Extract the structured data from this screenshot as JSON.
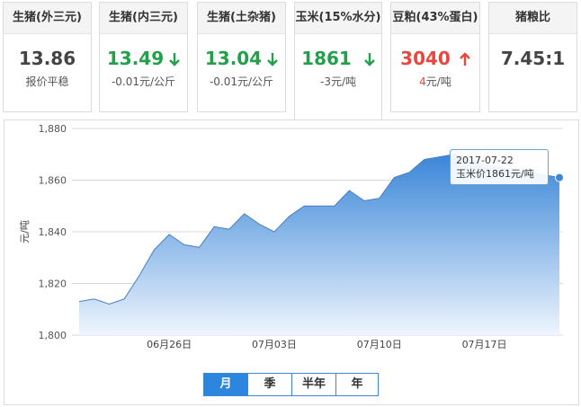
{
  "cards": [
    {
      "title": "生猪(外三元)",
      "value": "13.86",
      "sub": "报价平稳",
      "trend": "none"
    },
    {
      "title": "生猪(内三元)",
      "value": "13.49",
      "sub": "-0.01元/公斤",
      "trend": "down"
    },
    {
      "title": "生猪(土杂猪)",
      "value": "13.04",
      "sub": "-0.01元/公斤",
      "trend": "down"
    },
    {
      "title": "玉米(15%水分)",
      "value": "1861",
      "sub": "-3元/吨",
      "trend": "down"
    },
    {
      "title": "豆粕(43%蛋白)",
      "value": "3040",
      "sub_num": "4",
      "sub_unit": "元/吨",
      "trend": "up"
    },
    {
      "title": "猪粮比",
      "value": "7.45:1",
      "trend": "none"
    }
  ],
  "colors": {
    "down": "#23a04a",
    "up": "#e8463f",
    "accent": "#2c86de",
    "area_top": "#3a86d8",
    "area_bottom": "#eef5fd"
  },
  "tooltip": {
    "date": "2017-07-22",
    "text": "玉米价1861元/吨"
  },
  "tabs": [
    {
      "label": "月",
      "active": true
    },
    {
      "label": "季"
    },
    {
      "label": "半年"
    },
    {
      "label": "年"
    }
  ],
  "chart_data": {
    "type": "area",
    "ylabel": "元/吨",
    "ylim": [
      1800,
      1880
    ],
    "yticks": [
      "1,880",
      "1,860",
      "1,840",
      "1,820",
      "1,800"
    ],
    "xtick_labels": [
      "06月26日",
      "07月03日",
      "07月10日",
      "07月17日"
    ],
    "xtick_dates": [
      "2017-06-26",
      "2017-07-03",
      "2017-07-10",
      "2017-07-17"
    ],
    "grid": true,
    "series": [
      {
        "x": [
          "2017-06-20",
          "2017-06-21",
          "2017-06-22",
          "2017-06-23",
          "2017-06-24",
          "2017-06-25",
          "2017-06-26",
          "2017-06-27",
          "2017-06-28",
          "2017-06-29",
          "2017-06-30",
          "2017-07-01",
          "2017-07-02",
          "2017-07-03",
          "2017-07-04",
          "2017-07-05",
          "2017-07-06",
          "2017-07-07",
          "2017-07-08",
          "2017-07-09",
          "2017-07-10",
          "2017-07-11",
          "2017-07-12",
          "2017-07-13",
          "2017-07-14",
          "2017-07-15",
          "2017-07-16",
          "2017-07-17",
          "2017-07-18",
          "2017-07-19",
          "2017-07-20",
          "2017-07-21",
          "2017-07-22"
        ],
        "y": [
          1813,
          1814,
          1812,
          1814,
          1823,
          1833,
          1839,
          1835,
          1834,
          1842,
          1841,
          1847,
          1843,
          1840,
          1846,
          1850,
          1850,
          1850,
          1856,
          1852,
          1853,
          1861,
          1863,
          1868,
          1869,
          1870,
          1868,
          1866,
          1865,
          1864,
          1863,
          1862,
          1861
        ]
      }
    ]
  }
}
